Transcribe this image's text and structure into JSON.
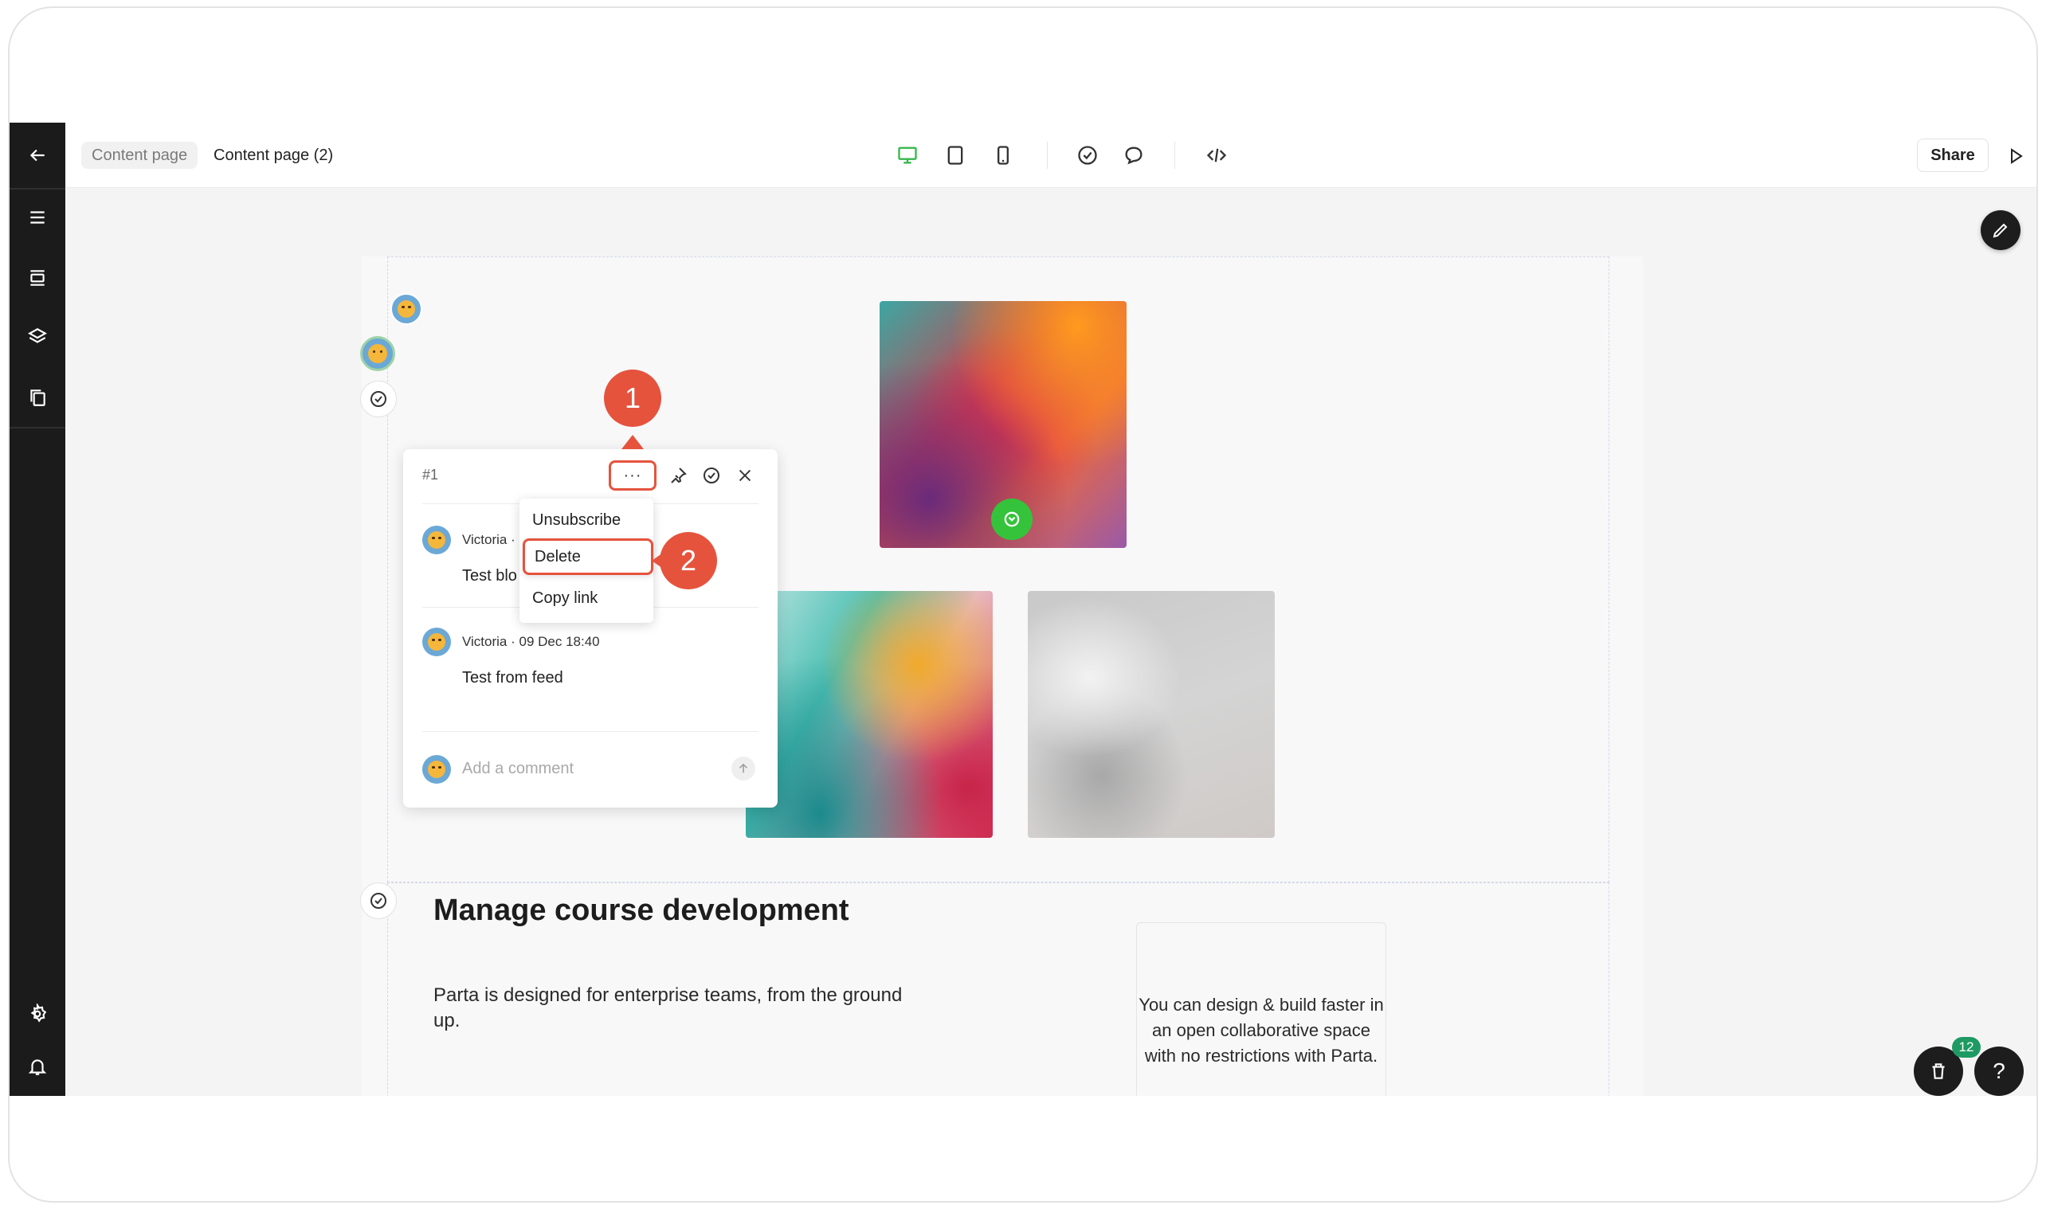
{
  "breadcrumb": {
    "parent": "Content page",
    "current": "Content page (2)"
  },
  "topbar": {
    "share_label": "Share"
  },
  "comment": {
    "number": "#1",
    "more_label": "···",
    "comments": [
      {
        "meta": "Victoria ·",
        "body": "Test blo"
      },
      {
        "meta": "Victoria · 09 Dec 18:40",
        "body": "Test from feed"
      }
    ],
    "input_placeholder": "Add a comment"
  },
  "menu": {
    "items": [
      "Unsubscribe",
      "Delete",
      "Copy link"
    ]
  },
  "steps": [
    "1",
    "2"
  ],
  "content": {
    "heading": "Manage course development",
    "paragraph": "Parta is designed for enterprise teams, from the ground up.",
    "card_text": "You can design & build faster in an open collaborative space with no restrictions with Parta."
  },
  "fab": {
    "badge_count": "12",
    "help_label": "?"
  },
  "colors": {
    "accent_step": "#e5533d",
    "sidebar_bg": "#1b1b1b",
    "device_active": "#35b84b",
    "badge_green": "#1e9a62"
  }
}
